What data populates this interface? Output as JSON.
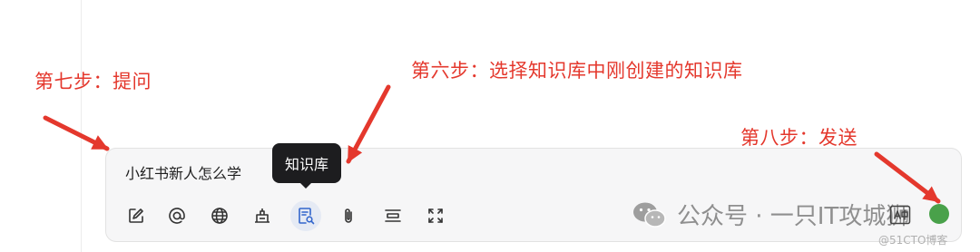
{
  "annotations": {
    "step7": "第七步：提问",
    "step6": "第六步：选择知识库中刚创建的知识库",
    "step8": "第八步：发送"
  },
  "chat": {
    "input_value": "小红书新人怎么学",
    "tooltip": "知识库",
    "toolbar_icons": [
      "edit-icon",
      "at-icon",
      "globe-icon",
      "plugin-icon",
      "knowledge-base-icon",
      "attachment-icon",
      "template-icon",
      "expand-icon"
    ]
  },
  "watermark": {
    "text": "公众号 · 一只IT攻城狮",
    "credit": "@51CTO博客"
  },
  "colors": {
    "annotation": "#e4382d",
    "send": "#49a14a",
    "tooltip_bg": "#1d1d1f",
    "active_tool_bg": "#e5eaf4"
  }
}
